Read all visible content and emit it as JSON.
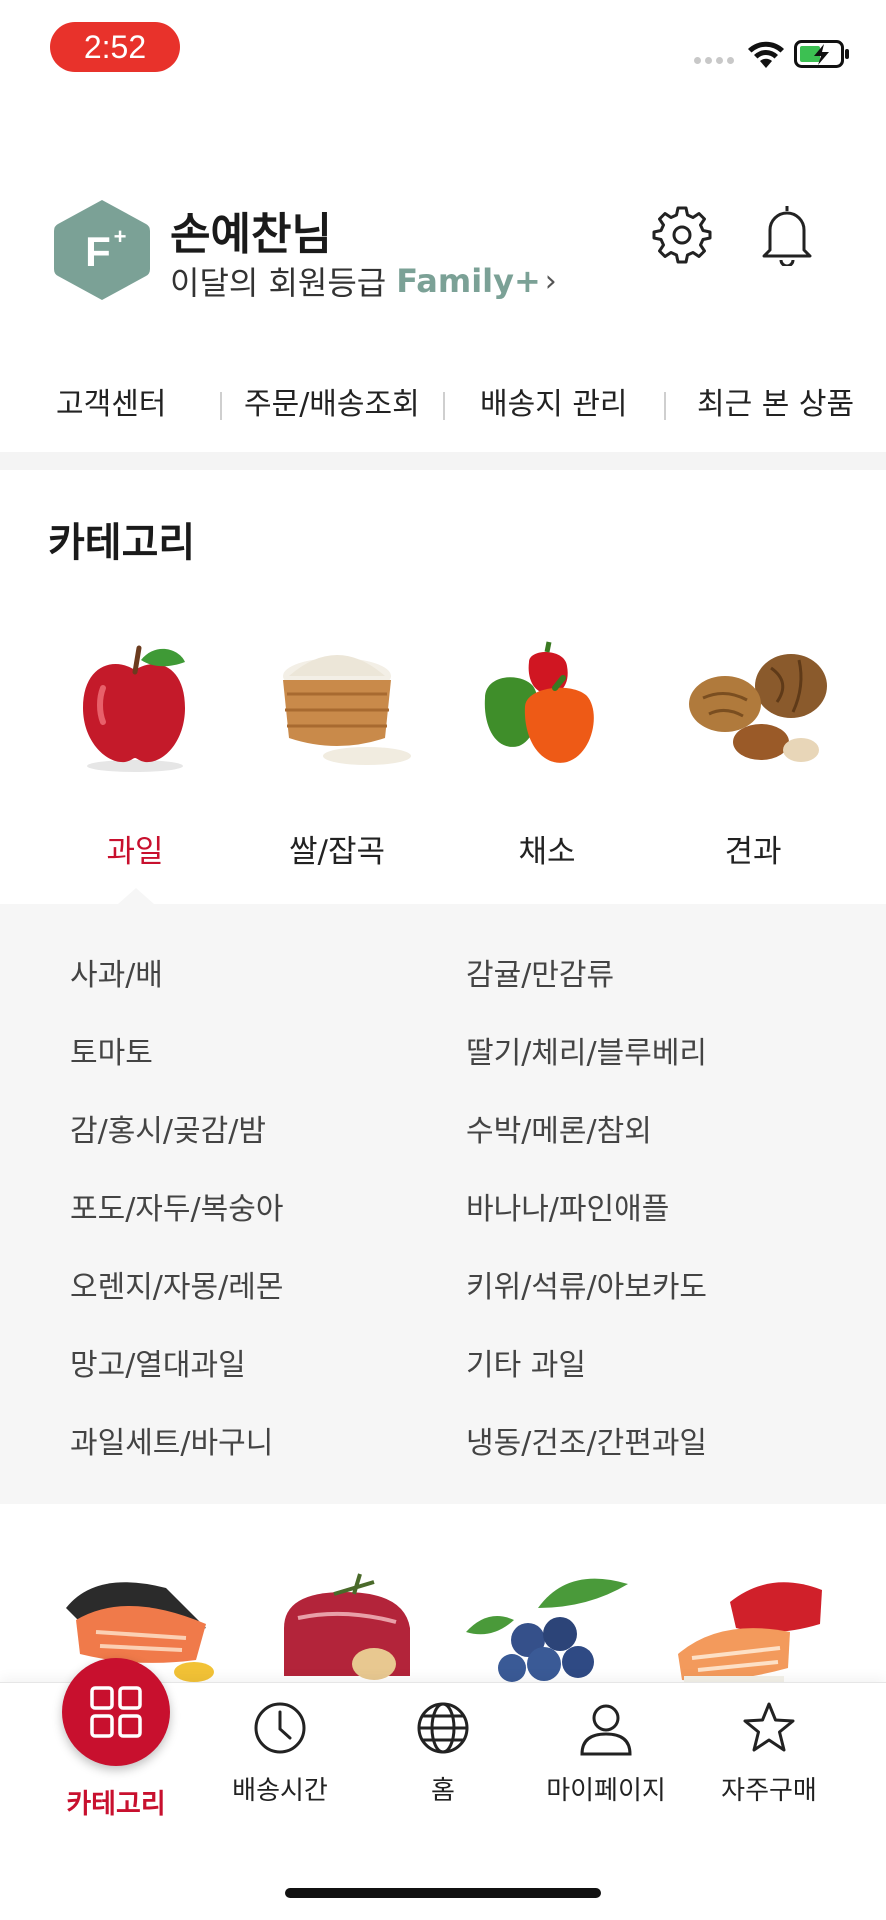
{
  "status_bar": {
    "time": "2:52"
  },
  "profile": {
    "badge_text": "F+",
    "name": "손예찬님",
    "grade_prefix": "이달의 회원등급",
    "grade_name": "Family+",
    "chevron": "›"
  },
  "header_icons": [
    "gear-icon",
    "bell-icon"
  ],
  "quick_links": [
    "고객센터",
    "주문/배송조회",
    "배송지 관리",
    "최근 본 상품"
  ],
  "category": {
    "title": "카테고리",
    "items": [
      {
        "label": "과일",
        "icon": "apple-image",
        "active": true
      },
      {
        "label": "쌀/잡곡",
        "icon": "rice-image",
        "active": false
      },
      {
        "label": "채소",
        "icon": "peppers-image",
        "active": false
      },
      {
        "label": "견과",
        "icon": "nuts-image",
        "active": false
      }
    ],
    "subcategories": [
      "사과/배",
      "감귤/만감류",
      "토마토",
      "딸기/체리/블루베리",
      "감/홍시/곶감/밤",
      "수박/메론/참외",
      "포도/자두/복숭아",
      "바나나/파인애플",
      "오렌지/자몽/레몬",
      "키위/석류/아보카도",
      "망고/열대과일",
      "기타 과일",
      "과일세트/바구니",
      "냉동/건조/간편과일"
    ],
    "second_row_icons": [
      "salmon-image",
      "beef-image",
      "blueberry-image",
      "sushi-image"
    ]
  },
  "bottom_nav": {
    "items": [
      {
        "label": "카테고리",
        "icon": "grid-icon",
        "active": true
      },
      {
        "label": "배송시간",
        "icon": "clock-icon",
        "active": false
      },
      {
        "label": "홈",
        "icon": "globe-icon",
        "active": false
      },
      {
        "label": "마이페이지",
        "icon": "person-icon",
        "active": false
      },
      {
        "label": "자주구매",
        "icon": "star-icon",
        "active": false
      }
    ]
  },
  "colors": {
    "accent_red": "#c8102e",
    "grade_green": "#7ba196",
    "panel_bg": "#f6f6f6"
  }
}
